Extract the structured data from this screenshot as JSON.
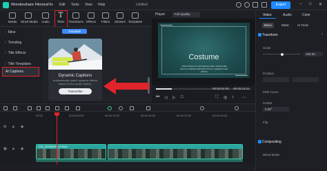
{
  "titlebar": {
    "app_title": "Wondershare Filmora",
    "menus": [
      "File",
      "Edit",
      "Tools",
      "View",
      "Help"
    ],
    "project_title": "Untitled",
    "export_label": "Export"
  },
  "media_tabs": [
    {
      "label": "Media",
      "icon": "media-icon"
    },
    {
      "label": "Stock Media",
      "icon": "stock-media-icon"
    },
    {
      "label": "Audio",
      "icon": "audio-icon"
    },
    {
      "label": "Titles",
      "icon": "titles-icon",
      "glyph": "T"
    },
    {
      "label": "Transitions",
      "icon": "transitions-icon"
    },
    {
      "label": "Effects",
      "icon": "effects-icon"
    },
    {
      "label": "Filters",
      "icon": "filters-icon"
    },
    {
      "label": "Stickers",
      "icon": "stickers-icon"
    },
    {
      "label": "Templates",
      "icon": "templates-icon"
    }
  ],
  "left_nav": {
    "items": [
      "Mine",
      "Trending",
      "Title Effects",
      "Title Templates"
    ],
    "ai_captions": "AI Captions"
  },
  "content": {
    "translate_label": "Translate",
    "card": {
      "title": "Dynamic Captions",
      "description": "Automatically match dynamic effects based on the audio rhythm.",
      "button": "Transcribe"
    }
  },
  "player": {
    "label": "Player",
    "quality": "Full Quality",
    "headline": "Costume",
    "subtitle": "OPEN IDEAS AS SPANDANA MAIN TOGETHER WITH A CHARACTER AND IN PLAY HEREIN THEY ABOVE",
    "time_current": "00:00:04:09",
    "time_total": "00:00:23:11",
    "progress": 0.17
  },
  "props": {
    "tabs": [
      "Video",
      "Audio",
      "Color"
    ],
    "subtabs": [
      "Basic",
      "Mask",
      "AI Tools"
    ],
    "sections": {
      "transform": "Transform",
      "scale": "Scale",
      "position": "Position",
      "path_curve": "Path Curve",
      "rotate": "Rotate",
      "flip": "Flip",
      "compositing": "Compositing",
      "blend_mode": "Blend Mode"
    },
    "scale_value": "100.00",
    "rotate_value": "0.00°"
  },
  "timeline": {
    "ruler": [
      "00:00",
      "00:00:05:00",
      "00:00:10:00",
      "00:00:15:00",
      "00:00:20:00",
      "00:00:25:00"
    ],
    "clip_name": "VID_20230925_174611"
  },
  "colors": {
    "accent": "#1f8bff",
    "highlight": "#e0242b",
    "clip": "#2aa6a0"
  }
}
